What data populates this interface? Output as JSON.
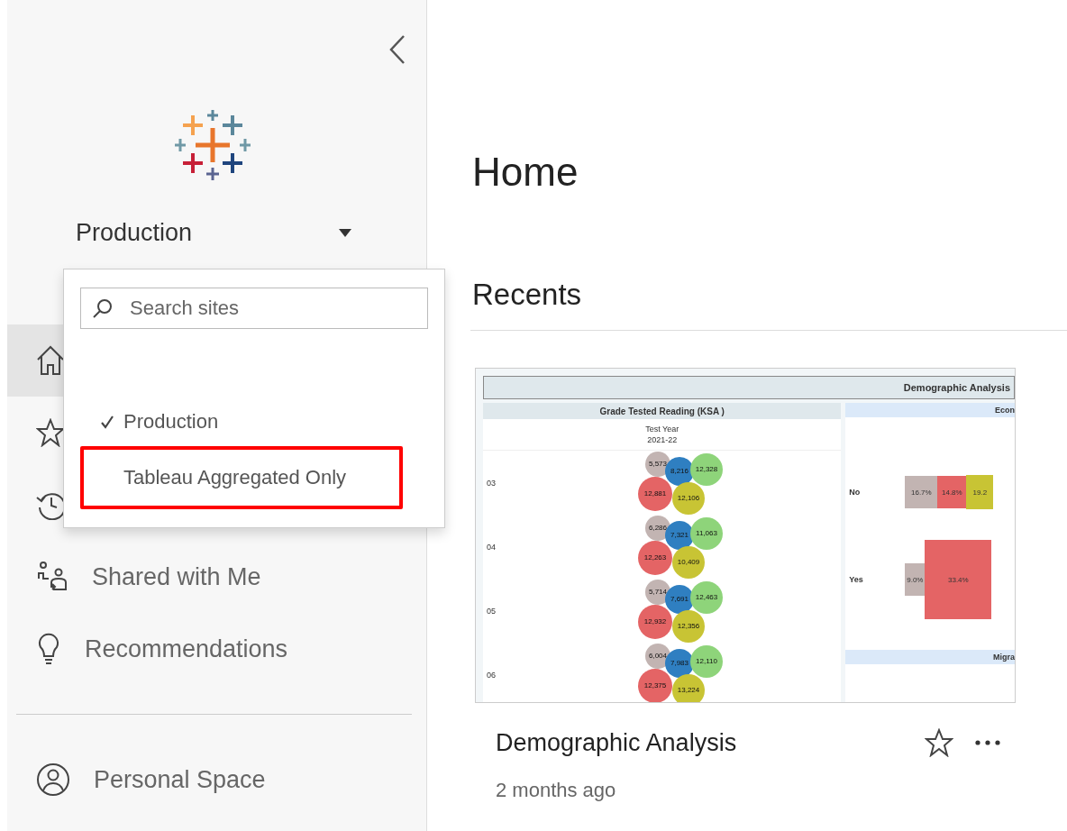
{
  "site_selector": {
    "label": "Production"
  },
  "site_menu": {
    "search": {
      "placeholder": "Search sites"
    },
    "items": [
      {
        "label": "Production",
        "selected": true,
        "highlighted": false
      },
      {
        "label": "Tableau Aggregated Only",
        "selected": false,
        "highlighted": true
      }
    ]
  },
  "sidebar": {
    "items": [
      {
        "kind": "home",
        "selected": true
      },
      {
        "kind": "favorites",
        "selected": false
      },
      {
        "kind": "recents",
        "selected": false
      },
      {
        "kind": "shared",
        "label": "Shared with Me",
        "selected": false
      },
      {
        "kind": "recommendations",
        "label": "Recommendations",
        "selected": false
      }
    ],
    "bottom_items": [
      {
        "kind": "personal",
        "label": "Personal Space",
        "selected": false
      }
    ]
  },
  "page": {
    "title": "Home",
    "section": "Recents"
  },
  "card": {
    "title": "Demographic Analysis",
    "time": "2 months ago",
    "thumbnail": {
      "title": "Demographic Analysis",
      "left_header": "Grade Tested Reading (KSA )",
      "column_label": "Test Year",
      "column_value": "2021-22",
      "rows": [
        {
          "label": "03",
          "bubbles": [
            {
              "value": "5,573",
              "color": "#c2b4b2"
            },
            {
              "value": "8,216",
              "color": "#2f7fc1"
            },
            {
              "value": "12,328",
              "color": "#8ed47a"
            },
            {
              "value": "12,881",
              "color": "#e46465"
            },
            {
              "value": "12,106",
              "color": "#c8c434"
            }
          ]
        },
        {
          "label": "04",
          "bubbles": [
            {
              "value": "6,286",
              "color": "#c2b4b2"
            },
            {
              "value": "7,321",
              "color": "#2f7fc1"
            },
            {
              "value": "11,063",
              "color": "#8ed47a"
            },
            {
              "value": "12,263",
              "color": "#e46465"
            },
            {
              "value": "10,409",
              "color": "#c8c434"
            }
          ]
        },
        {
          "label": "05",
          "bubbles": [
            {
              "value": "5,714",
              "color": "#c2b4b2"
            },
            {
              "value": "7,691",
              "color": "#2f7fc1"
            },
            {
              "value": "12,463",
              "color": "#8ed47a"
            },
            {
              "value": "12,932",
              "color": "#e46465"
            },
            {
              "value": "12,356",
              "color": "#c8c434"
            }
          ]
        },
        {
          "label": "06",
          "bubbles": [
            {
              "value": "6,004",
              "color": "#c2b4b2"
            },
            {
              "value": "7,983",
              "color": "#2f7fc1"
            },
            {
              "value": "12,110",
              "color": "#8ed47a"
            },
            {
              "value": "12,375",
              "color": "#e46465"
            },
            {
              "value": "13,224",
              "color": "#c8c434"
            }
          ]
        }
      ],
      "right_header": "Econ",
      "right_footer_header": "Migra",
      "bar_rows": [
        {
          "label": "No",
          "segments": [
            {
              "value": "16.7%",
              "color": "#c2b4b2"
            },
            {
              "value": "14.8%",
              "color": "#e46465"
            },
            {
              "value": "19.2",
              "color": "#c8c434"
            }
          ]
        },
        {
          "label": "Yes",
          "segments": [
            {
              "value": "9.0%",
              "color": "#c2b4b2"
            },
            {
              "value": "33.4%",
              "color": "#e46465"
            }
          ]
        }
      ]
    }
  }
}
